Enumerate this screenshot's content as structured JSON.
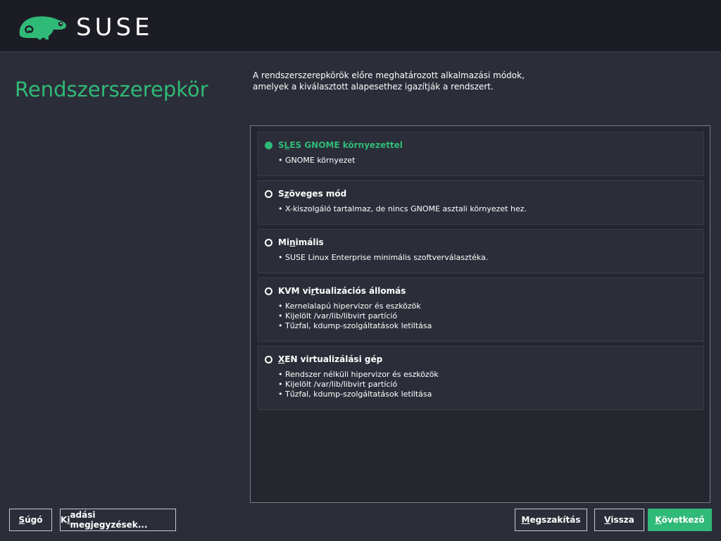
{
  "brand": {
    "logo_text": "SUSE",
    "accent_color": "#30ba78",
    "logo_icon": "chameleon-icon"
  },
  "page": {
    "title": "Rendszerszerepkör",
    "description_lines": [
      "A rendszerszerepkörök előre meghatározott alkalmazási módok,",
      "amelyek a kiválasztott alapesethez igazítják a rendszert."
    ]
  },
  "roles": [
    {
      "title_before": "S",
      "title_mnemonic": "L",
      "title_after": "ES GNOME környezettel",
      "selected": true,
      "bullets": [
        "• GNOME környezet"
      ]
    },
    {
      "title_before": "S",
      "title_mnemonic": "z",
      "title_after": "öveges mód",
      "selected": false,
      "bullets": [
        "• X-kiszolgáló tartalmaz, de nincs GNOME asztali környezet hez."
      ]
    },
    {
      "title_before": "Mi",
      "title_mnemonic": "n",
      "title_after": "imális",
      "selected": false,
      "bullets": [
        "• SUSE Linux Enterprise minimális szoftverválasztéka."
      ]
    },
    {
      "title_before": "KVM vi",
      "title_mnemonic": "r",
      "title_after": "tualizációs állomás",
      "selected": false,
      "bullets": [
        "• Kernelalapú hipervizor és eszközök",
        "• Kijelölt /var/lib/libvirt partíció",
        "• Tűzfal, kdump-szolgáltatások letiltása"
      ]
    },
    {
      "title_before": "",
      "title_mnemonic": "X",
      "title_after": "EN virtualizálási gép",
      "selected": false,
      "bullets": [
        "• Rendszer nélküli hipervizor és eszközök",
        "• Kijelölt /var/lib/libvirt partíció",
        "• Tűzfal, kdump-szolgáltatások letiltása"
      ]
    }
  ],
  "buttons": {
    "help": {
      "before": "",
      "mnemonic": "S",
      "after": "úgó"
    },
    "release_notes": {
      "before": "K",
      "mnemonic": "i",
      "after": "adási megjegyzések..."
    },
    "abort": {
      "before": "",
      "mnemonic": "M",
      "after": "egszakítás"
    },
    "back": {
      "before": "",
      "mnemonic": "V",
      "after": "issza"
    },
    "next": {
      "before": "",
      "mnemonic": "K",
      "after": "övetkező"
    }
  }
}
